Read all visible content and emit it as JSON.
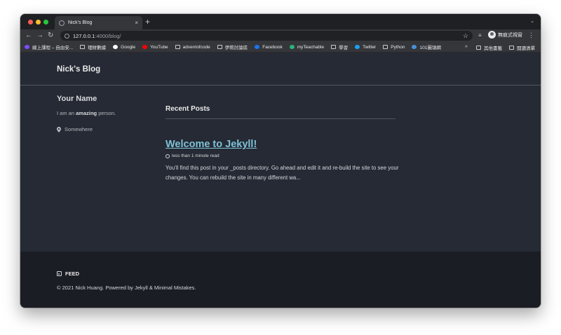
{
  "browser": {
    "tab": {
      "title": "Nick's Blog",
      "close": "×"
    },
    "new_tab": "+",
    "tab_menu": "⌄",
    "nav": {
      "back": "←",
      "forward": "→",
      "reload": "↻"
    },
    "url": {
      "host": "127.0.0.1",
      "rest": ":4000/blog/"
    },
    "star": "☆",
    "profile_label": "無痕式視窗",
    "menu": "⋮",
    "bookmarks": [
      {
        "label": "線上課程 – 自由安...",
        "icon": "course-icon",
        "color": "#7c4dff"
      },
      {
        "label": "理財數據",
        "icon": "folder-icon"
      },
      {
        "label": "Google",
        "icon": "google-icon",
        "color": "#ffffff"
      },
      {
        "label": "YouTube",
        "icon": "youtube-icon",
        "color": "#ff0000"
      },
      {
        "label": "adventofcode",
        "icon": "folder-icon"
      },
      {
        "label": "伊莉討論區",
        "icon": "folder-icon"
      },
      {
        "label": "Facebook",
        "icon": "facebook-icon",
        "color": "#1877f2"
      },
      {
        "label": "myTeachable",
        "icon": "teachable-icon",
        "color": "#26b67c"
      },
      {
        "label": "學習",
        "icon": "folder-icon"
      },
      {
        "label": "Twitter",
        "icon": "twitter-icon",
        "color": "#1da1f2"
      },
      {
        "label": "Python",
        "icon": "folder-icon"
      },
      {
        "label": "101圖領網",
        "icon": "site-icon",
        "color": "#4a90d9"
      }
    ],
    "bookmarks_more": "»",
    "other_bookmarks": "其他書籤",
    "reading_list": "閱讀清單"
  },
  "site": {
    "title": "Nick's Blog",
    "author": {
      "name": "Your Name",
      "bio_prefix": "I am an ",
      "bio_strong": "amazing",
      "bio_suffix": " person.",
      "location": "Somewhere"
    },
    "recent_posts_title": "Recent Posts",
    "posts": [
      {
        "title": "Welcome to Jekyll!",
        "read_time": "less than 1 minute read",
        "excerpt": "You’ll find this post in your _posts directory. Go ahead and edit it and re-build the site to see your changes. You can rebuild the site in many different wa..."
      }
    ],
    "footer": {
      "feed_label": "FEED",
      "copyright": "© 2021 Nick Huang. Powered by Jekyll & Minimal Mistakes."
    }
  },
  "colors": {
    "page_bg": "#252a34",
    "footer_bg": "#1b1d24",
    "link": "#7fc2d8"
  }
}
